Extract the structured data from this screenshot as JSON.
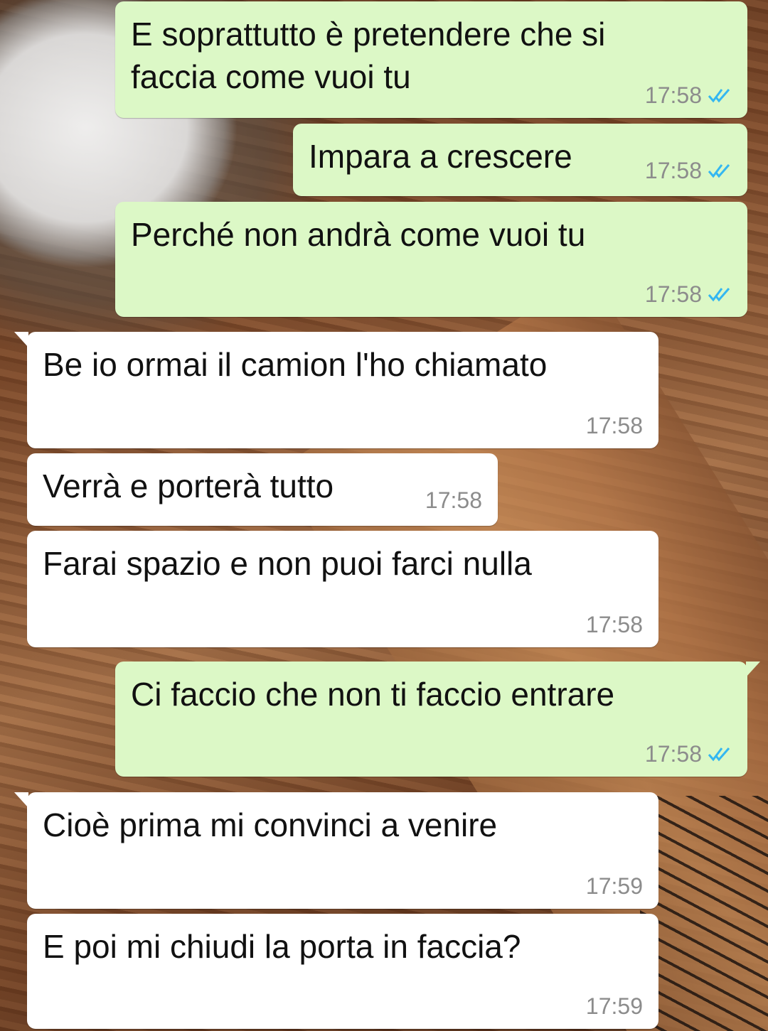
{
  "chat": {
    "messages": [
      {
        "direction": "out",
        "text": "E soprattutto è pretendere che si\nfaccia come vuoi tu",
        "time": "17:58",
        "status_icon": "double-check-read-icon",
        "tick_color": "#34b7f1"
      },
      {
        "direction": "out",
        "text": "Impara a crescere",
        "time": "17:58",
        "status_icon": "double-check-read-icon",
        "tick_color": "#34b7f1"
      },
      {
        "direction": "out",
        "text": "Perché non andrà come vuoi tu",
        "time": "17:58",
        "status_icon": "double-check-read-icon",
        "tick_color": "#34b7f1"
      },
      {
        "direction": "in",
        "text": "Be io ormai il camion l'ho chiamato",
        "time": "17:58"
      },
      {
        "direction": "in",
        "text": "Verrà e porterà tutto",
        "time": "17:58"
      },
      {
        "direction": "in",
        "text": "Farai spazio e non puoi farci nulla",
        "time": "17:58"
      },
      {
        "direction": "out",
        "text": "Ci faccio che non ti faccio entrare",
        "time": "17:58",
        "status_icon": "double-check-read-icon",
        "tick_color": "#34b7f1"
      },
      {
        "direction": "in",
        "text": "Cioè prima mi convinci a venire",
        "time": "17:59"
      },
      {
        "direction": "in",
        "text": "E poi mi chiudi la porta in faccia?",
        "time": "17:59"
      }
    ]
  },
  "colors": {
    "outgoing_bubble": "#dcf8c6",
    "incoming_bubble": "#ffffff",
    "timestamp": "#8c8c8c",
    "read_ticks": "#34b7f1"
  }
}
